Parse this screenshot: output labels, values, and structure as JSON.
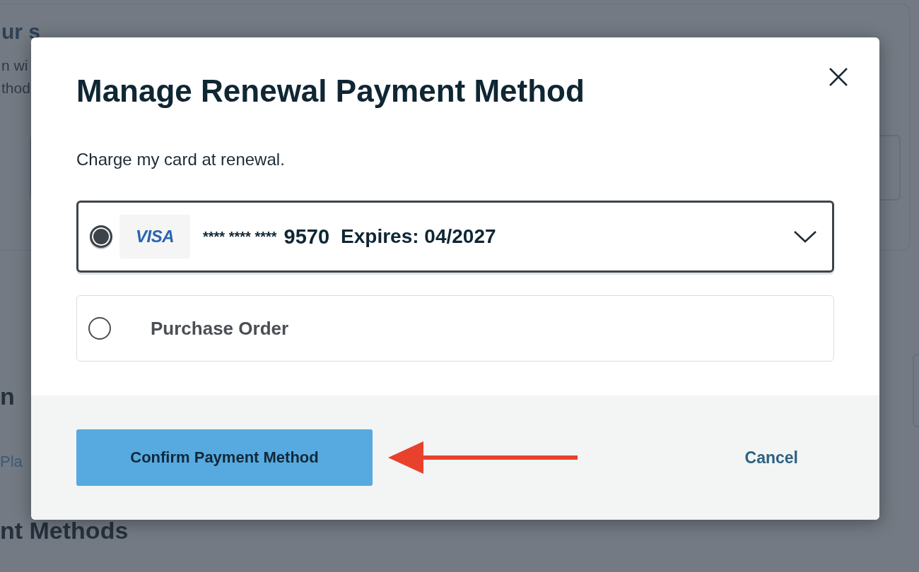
{
  "background": {
    "heading_fragment": "ur s",
    "text_fragments": [
      "n wi",
      "thod"
    ],
    "section_fragment": "n",
    "link_fragment": "Pla",
    "section_fragment_2": "nt Methods"
  },
  "modal": {
    "title": "Manage Renewal Payment Method",
    "subtitle": "Charge my card at renewal.",
    "options": [
      {
        "kind": "card",
        "selected": true,
        "brand": "VISA",
        "masked": "**** **** ****",
        "last4": "9570",
        "expiry": "Expires: 04/2027"
      },
      {
        "kind": "purchase_order",
        "selected": false,
        "label": "Purchase Order"
      }
    ],
    "confirm_button": "Confirm Payment Method",
    "cancel_button": "Cancel"
  }
}
